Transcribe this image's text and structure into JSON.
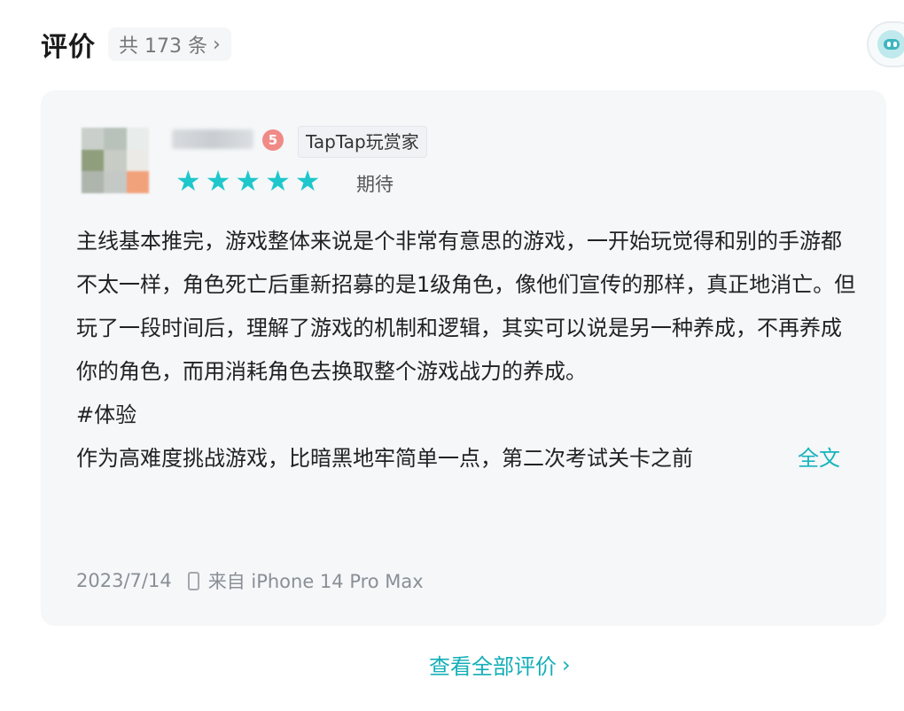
{
  "header": {
    "title": "评价",
    "count_label": "共 173 条",
    "chevron": "›"
  },
  "review": {
    "username": "",
    "level_icon": "level-badge-icon",
    "level_mark": "5",
    "badge": "TapTap玩赏家",
    "rating": 5,
    "stars": [
      "★",
      "★",
      "★",
      "★",
      "★"
    ],
    "rating_label": "期待",
    "paragraphs": [
      "主线基本推完，游戏整体来说是个非常有意思的游戏，一开始玩觉得和别的手游都不太一样，角色死亡后重新招募的是1级角色，像他们宣传的那样，真正地消亡。但玩了一段时间后，理解了游戏的机制和逻辑，其实可以说是另一种养成，不再养成你的角色，而用消耗角色去换取整个游戏战力的养成。",
      "#体验"
    ],
    "truncated_line": "作为高难度挑战游戏，比暗黑地牢简单一点，第二次考试关卡之前",
    "expand_label": "全文",
    "date": "2023/7/14",
    "device": "来自 iPhone 14 Pro Max"
  },
  "footer": {
    "view_all_label": "查看全部评价",
    "chevron": "›"
  },
  "colors": {
    "accent": "#18b4bd",
    "star": "#1ec7cb",
    "card_bg": "#f5f7f9"
  }
}
